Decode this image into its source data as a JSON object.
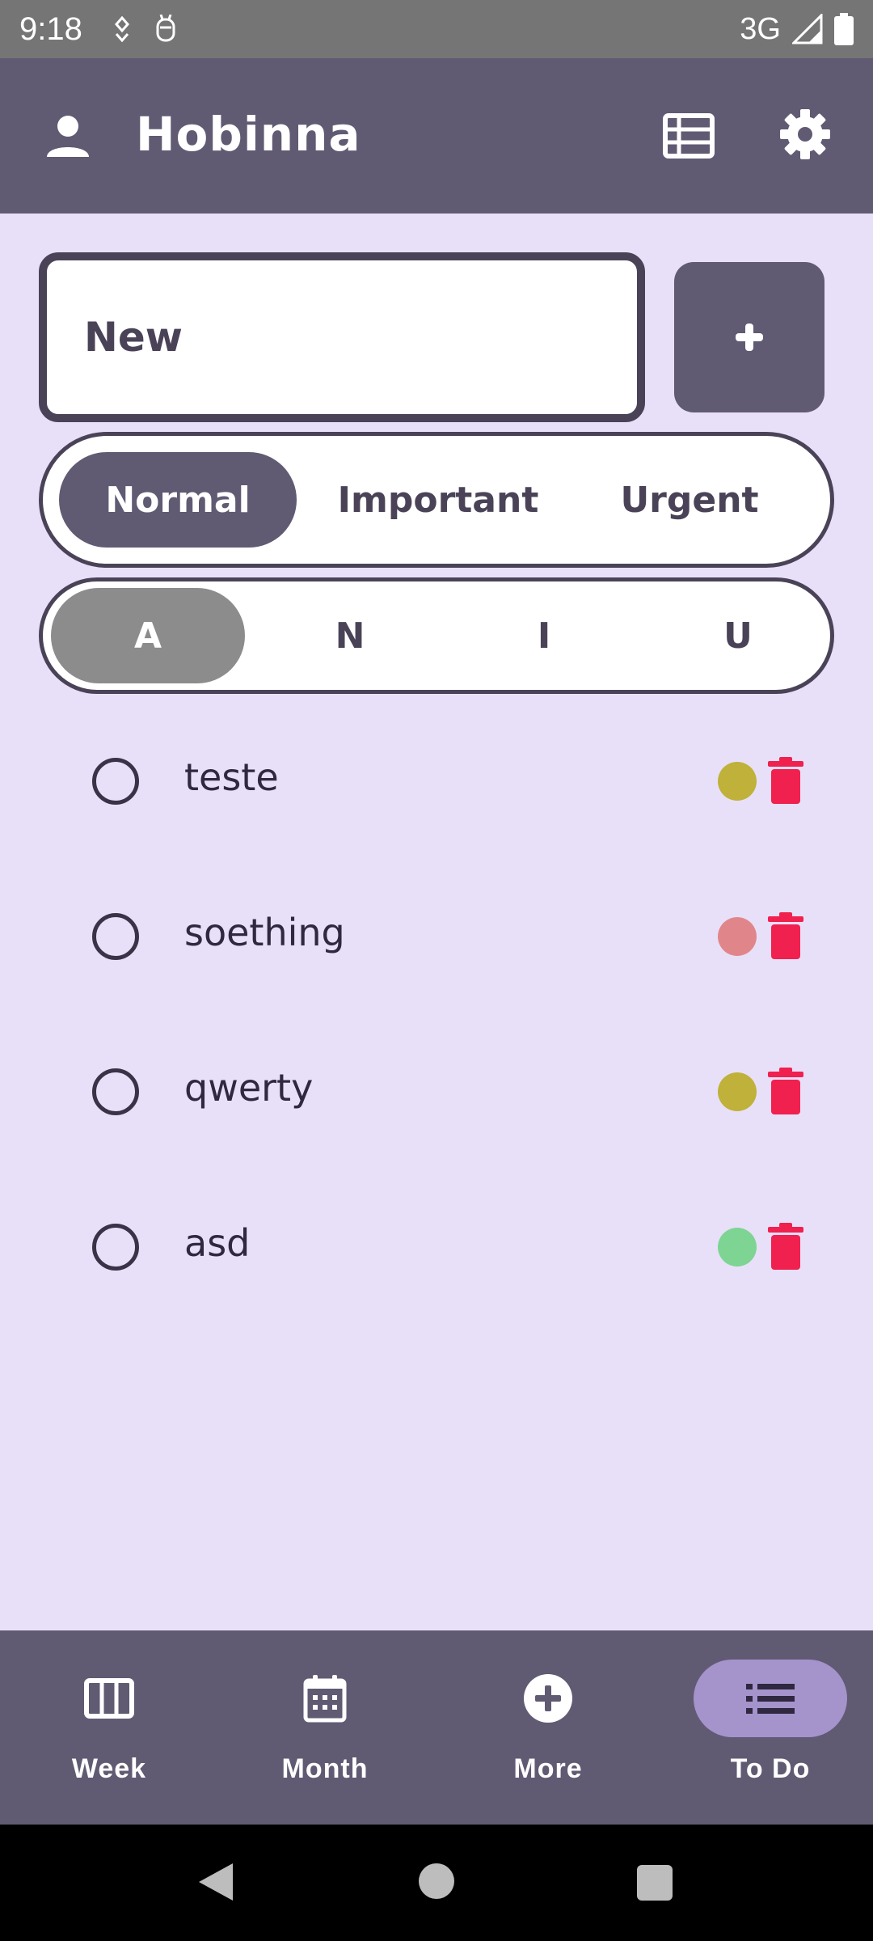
{
  "status_bar": {
    "time": "9:18",
    "network": "3G",
    "icons": [
      "location-pin-icon",
      "bug-icon",
      "signal-icon",
      "battery-icon"
    ]
  },
  "app_bar": {
    "title": "Hobinna",
    "icons": [
      "person-icon",
      "list-view-icon",
      "gear-icon"
    ]
  },
  "new_task": {
    "placeholder": "New",
    "add_icon": "plus-icon"
  },
  "priority_options": [
    {
      "label": "Normal",
      "selected": true
    },
    {
      "label": "Important",
      "selected": false
    },
    {
      "label": "Urgent",
      "selected": false
    }
  ],
  "filter_options": [
    {
      "label": "A",
      "selected": true
    },
    {
      "label": "N",
      "selected": false
    },
    {
      "label": "I",
      "selected": false
    },
    {
      "label": "U",
      "selected": false
    }
  ],
  "tasks": [
    {
      "label": "teste",
      "done": false,
      "priority_color": "#bfb139"
    },
    {
      "label": "soething",
      "done": false,
      "priority_color": "#e0868b"
    },
    {
      "label": "qwerty",
      "done": false,
      "priority_color": "#bfb139"
    },
    {
      "label": "asd",
      "done": false,
      "priority_color": "#7ed493"
    }
  ],
  "bottom_nav": [
    {
      "label": "Week",
      "icon": "week-columns-icon",
      "active": false
    },
    {
      "label": "Month",
      "icon": "calendar-icon",
      "active": false
    },
    {
      "label": "More",
      "icon": "plus-circle-icon",
      "active": false
    },
    {
      "label": "To Do",
      "icon": "list-icon",
      "active": true
    }
  ],
  "colors": {
    "app_bar": "#615a73",
    "background": "#e8e0f8",
    "delete": "#f0204f",
    "nav_active": "#a593cc"
  }
}
